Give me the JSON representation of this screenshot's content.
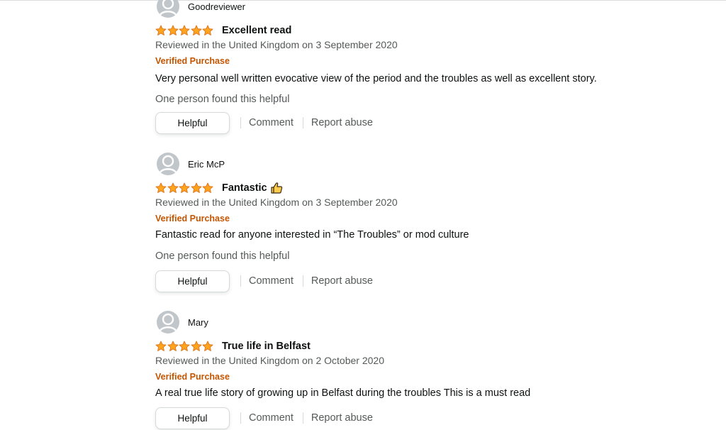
{
  "reviews": [
    {
      "reviewer": "Goodreviewer",
      "rating": 5,
      "title": "Excellent read",
      "has_thumb_icon": false,
      "reviewed": "Reviewed in the United Kingdom on 3 September 2020",
      "verified": "Verified Purchase",
      "body": "Very personal well written evocative view of the period and the troubles as well as excellent story.",
      "helpful_count": "One person found this helpful"
    },
    {
      "reviewer": "Eric McP",
      "rating": 5,
      "title": "Fantastic",
      "has_thumb_icon": true,
      "reviewed": "Reviewed in the United Kingdom on 3 September 2020",
      "verified": "Verified Purchase",
      "body": "Fantastic read for anyone interested in “The Troubles” or mod culture",
      "helpful_count": "One person found this helpful"
    },
    {
      "reviewer": "Mary",
      "rating": 5,
      "title": "True life in Belfast",
      "has_thumb_icon": false,
      "reviewed": "Reviewed in the United Kingdom on 2 October 2020",
      "verified": "Verified Purchase",
      "body": "A real true life story of growing up in Belfast during the troubles This is a must read",
      "helpful_count": ""
    }
  ],
  "actions": {
    "helpful_label": "Helpful",
    "comment_label": "Comment",
    "report_label": "Report abuse"
  },
  "colors": {
    "star": "#ffa41c",
    "star_outline": "#de7921",
    "verified": "#c45500",
    "muted": "#565959"
  },
  "icons": {
    "avatar": "default-avatar-icon",
    "star": "star-icon",
    "thumb": "thumbs-up-icon"
  }
}
